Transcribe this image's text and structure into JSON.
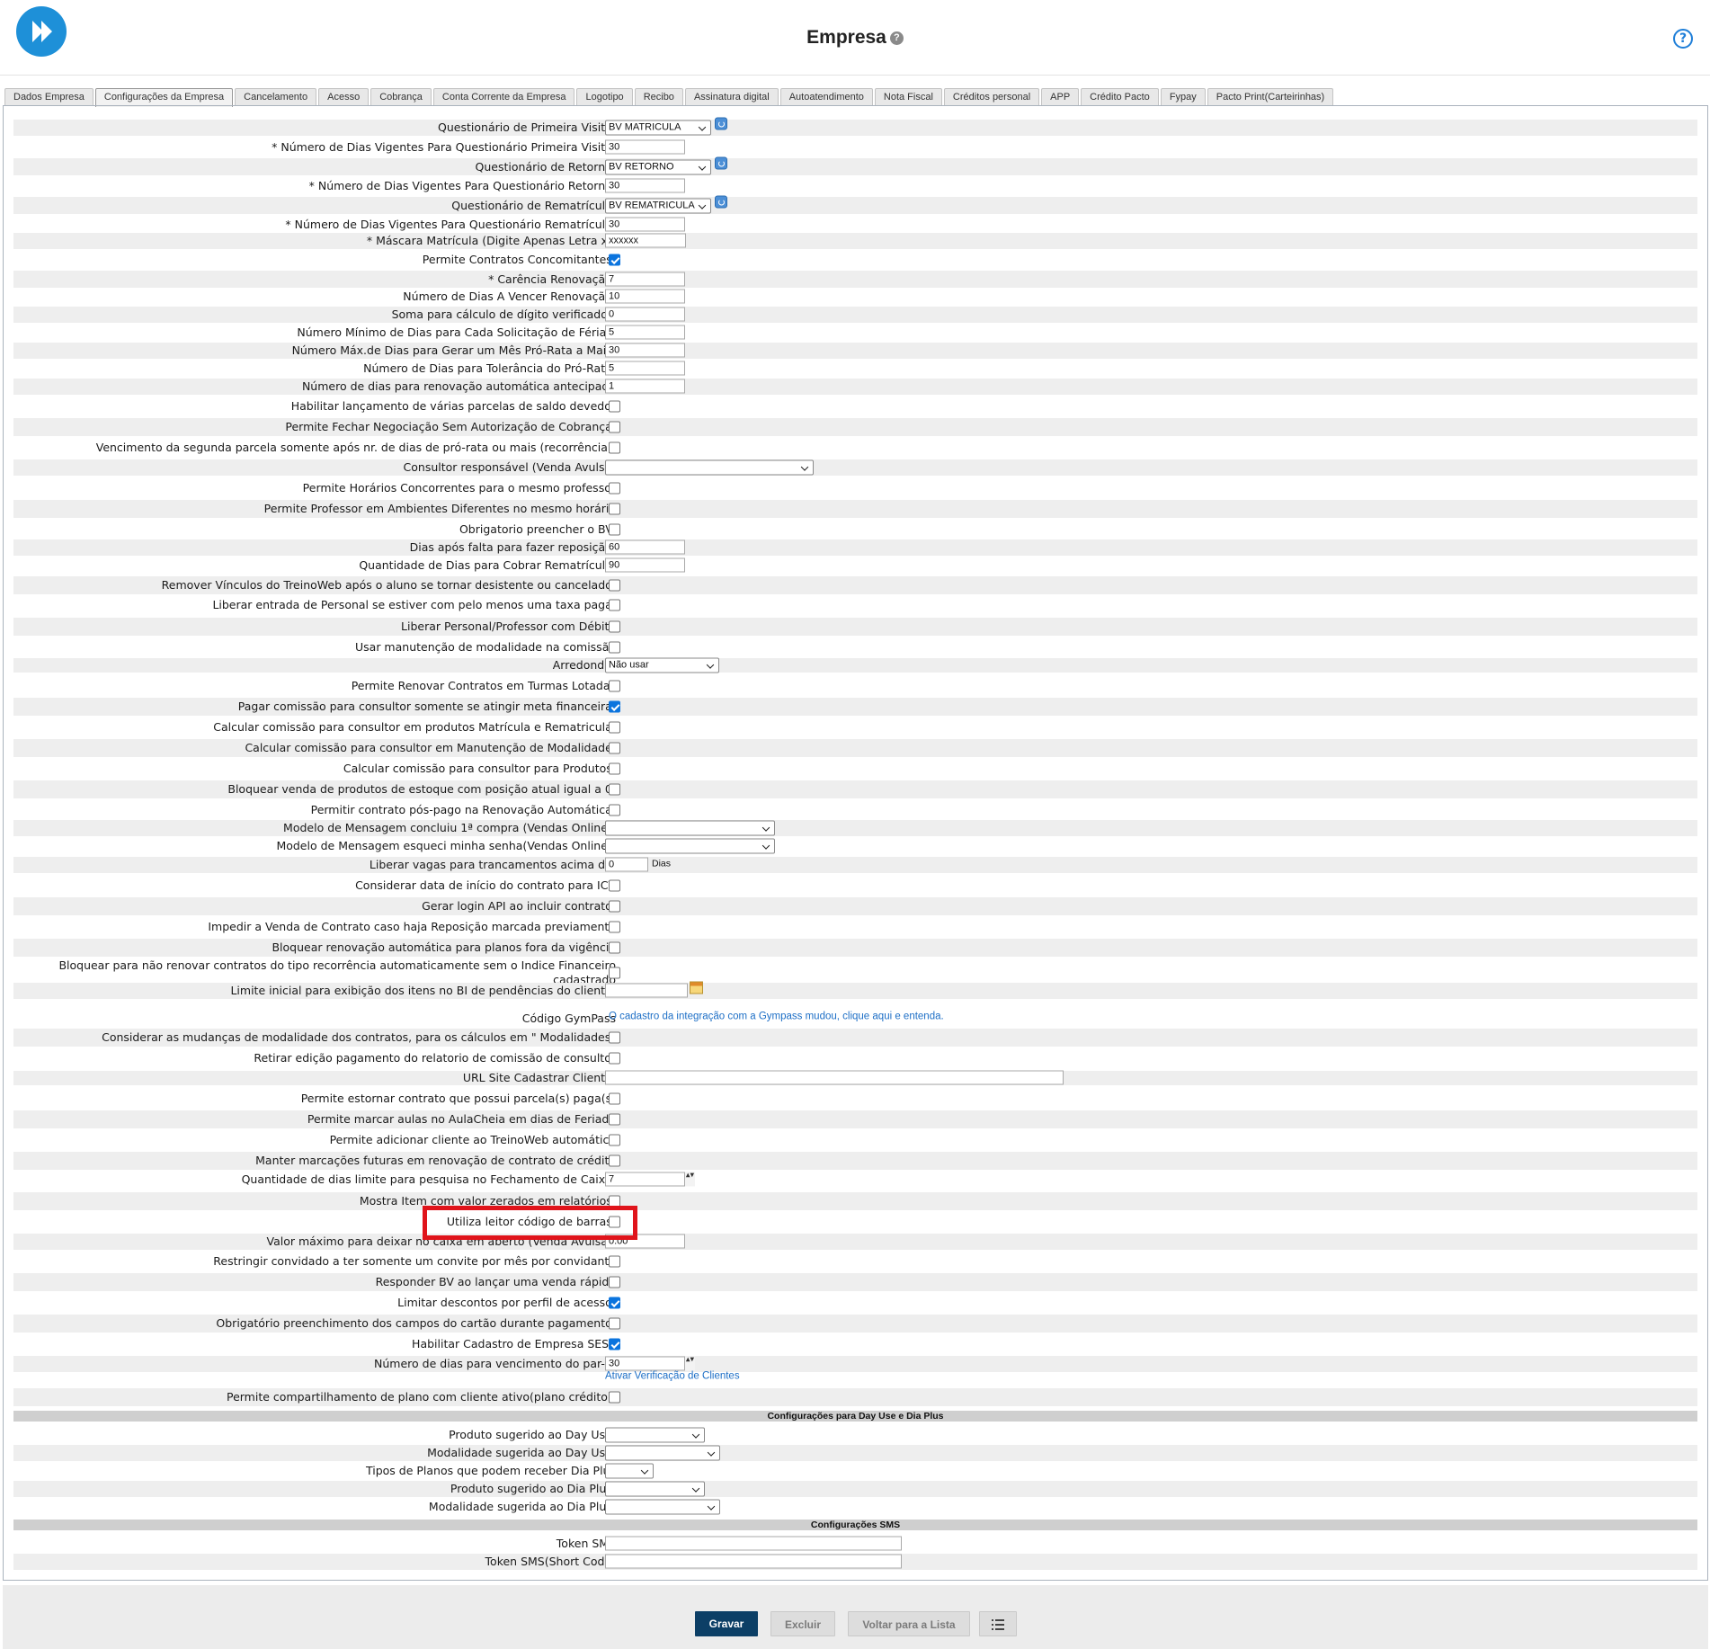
{
  "header": {
    "title": "Empresa",
    "title_help": "?",
    "help": "?"
  },
  "tabs": [
    "Dados Empresa",
    "Configurações da Empresa",
    "Cancelamento",
    "Acesso",
    "Cobrança",
    "Conta Corrente da Empresa",
    "Logotipo",
    "Recibo",
    "Assinatura digital",
    "Autoatendimento",
    "Nota Fiscal",
    "Créditos personal",
    "APP",
    "Crédito Pacto",
    "Fypay",
    "Pacto Print(Carteirinhas)"
  ],
  "active_tab": "Configurações da Empresa",
  "fields": [
    {
      "label": "Questionário de Primeira Visita:",
      "type": "select",
      "value": "BV MATRICULA",
      "refresh": true
    },
    {
      "label": "* Número de Dias Vigentes Para Questionário Primeira Visita:",
      "type": "input",
      "value": "30"
    },
    {
      "label": "Questionário de Retorno:",
      "type": "select",
      "value": "BV RETORNO",
      "refresh": true
    },
    {
      "label": "* Número de Dias Vigentes Para Questionário Retorno:",
      "type": "input",
      "value": "30"
    },
    {
      "label": "Questionário de Rematrícula:",
      "type": "select",
      "value": "BV REMATRICULA",
      "refresh": true
    },
    {
      "label": "* Número de Dias Vigentes Para Questionário Rematrícula:",
      "type": "input",
      "value": "30"
    },
    {
      "label": "* Máscara Matrícula (Digite Apenas Letra x):",
      "type": "input",
      "value": "xxxxxx"
    },
    {
      "label": "Permite Contratos Concomitantes:",
      "type": "checkbox",
      "checked": true
    },
    {
      "label": "* Carência Renovação:",
      "type": "input",
      "value": "7"
    },
    {
      "label": "Número de Dias A Vencer Renovação:",
      "type": "input",
      "value": "10"
    },
    {
      "label": "Soma para cálculo de dígito verificador:",
      "type": "input",
      "value": "0"
    },
    {
      "label": "Número Mínimo de Dias para Cada Solicitação de Férias:",
      "type": "input",
      "value": "5"
    },
    {
      "label": "Número Máx.de Dias para Gerar um Mês Pró-Rata a Mais:",
      "type": "input",
      "value": "30"
    },
    {
      "label": "Número de Dias para Tolerância do Pró-Rata:",
      "type": "input",
      "value": "5"
    },
    {
      "label": "Número de dias para renovação automática antecipada",
      "type": "input",
      "value": "1"
    },
    {
      "label": "Habilitar lançamento de várias parcelas de saldo devedor",
      "type": "checkbox",
      "checked": false
    },
    {
      "label": "Permite Fechar Negociação Sem Autorização de Cobrança:",
      "type": "checkbox",
      "checked": false
    },
    {
      "label": "Vencimento da segunda parcela somente após nr. de dias de pró-rata ou mais (recorrência):",
      "type": "checkbox",
      "checked": false
    },
    {
      "label": "Consultor responsável (Venda Avulsa)",
      "type": "select",
      "value": ""
    },
    {
      "label": "Permite Horários Concorrentes para o mesmo professor",
      "type": "checkbox",
      "checked": false
    },
    {
      "label": "Permite Professor em Ambientes Diferentes no mesmo horário",
      "type": "checkbox",
      "checked": false
    },
    {
      "label": "Obrigatorio preencher o BV:",
      "type": "checkbox",
      "checked": false
    },
    {
      "label": "Dias após falta para fazer reposição:",
      "type": "input",
      "value": "60"
    },
    {
      "label": "Quantidade de Dias para Cobrar Rematrícula:",
      "type": "input",
      "value": "90"
    },
    {
      "label": "Remover Vínculos do TreinoWeb após o aluno se tornar desistente ou cancelado:",
      "type": "checkbox",
      "checked": false
    },
    {
      "label": "Liberar entrada de Personal se estiver com pelo menos uma taxa paga:",
      "type": "checkbox",
      "checked": false
    },
    {
      "label": "Liberar Personal/Professor com Débito",
      "type": "checkbox",
      "checked": false
    },
    {
      "label": "Usar manutenção de modalidade na comissão",
      "type": "checkbox",
      "checked": false
    },
    {
      "label": "Arredondar",
      "type": "select",
      "value": "Não usar"
    },
    {
      "label": "Permite Renovar Contratos em Turmas Lotadas",
      "type": "checkbox",
      "checked": false
    },
    {
      "label": "Pagar comissão para consultor somente se atingir meta financeira:",
      "type": "checkbox",
      "checked": true
    },
    {
      "label": "Calcular comissão para consultor em produtos Matrícula e Rematricula:",
      "type": "checkbox",
      "checked": false
    },
    {
      "label": "Calcular comissão para consultor em Manutenção de Modalidade:",
      "type": "checkbox",
      "checked": false
    },
    {
      "label": "Calcular comissão para consultor para Produtos:",
      "type": "checkbox",
      "checked": false
    },
    {
      "label": "Bloquear venda de produtos de estoque com posição atual igual a 0:",
      "type": "checkbox",
      "checked": false
    },
    {
      "label": "Permitir contrato pós-pago na Renovação Automática:",
      "type": "checkbox",
      "checked": false
    },
    {
      "label": "Modelo de Mensagem concluiu 1ª compra (Vendas Online):",
      "type": "select",
      "value": ""
    },
    {
      "label": "Modelo de Mensagem esqueci minha senha(Vendas Online):",
      "type": "select",
      "value": ""
    },
    {
      "label": "Liberar vagas para trancamentos acima de:",
      "type": "input",
      "value": "0",
      "suffix": "Dias"
    },
    {
      "label": "Considerar data de início do contrato para ICV",
      "type": "checkbox",
      "checked": false
    },
    {
      "label": "Gerar login API ao incluir contrato:",
      "type": "checkbox",
      "checked": false
    },
    {
      "label": "Impedir a Venda de Contrato caso haja Reposição marcada previamente",
      "type": "checkbox",
      "checked": false
    },
    {
      "label": "Bloquear renovação automática para planos fora da vigência",
      "type": "checkbox",
      "checked": false
    },
    {
      "label": "Bloquear para não renovar contratos do tipo recorrência automaticamente sem o Indice Financeiro cadastrado",
      "type": "checkbox",
      "checked": false
    },
    {
      "label": "Limite inicial para exibição dos itens no BI de pendências do cliente:",
      "type": "date",
      "value": ""
    },
    {
      "label": "Código GymPass",
      "type": "link",
      "value": "O cadastro da integração com a Gympass mudou, clique aqui e entenda."
    },
    {
      "label": "Considerar as mudanças de modalidade dos contratos, para os cálculos em \" Modalidades\"",
      "type": "checkbox",
      "checked": false
    },
    {
      "label": "Retirar edição pagamento do relatorio de comissão de consultor",
      "type": "checkbox",
      "checked": false
    },
    {
      "label": "URL Site Cadastrar Cliente:",
      "type": "input",
      "value": ""
    },
    {
      "label": "Permite estornar contrato que possui parcela(s) paga(s)",
      "type": "checkbox",
      "checked": false
    },
    {
      "label": "Permite marcar aulas no AulaCheia em dias de Feriado",
      "type": "checkbox",
      "checked": false
    },
    {
      "label": "Permite adicionar cliente ao TreinoWeb automático",
      "type": "checkbox",
      "checked": false
    },
    {
      "label": "Manter marcações futuras em renovação de contrato de crédito",
      "type": "checkbox",
      "checked": false
    },
    {
      "label": "Quantidade de dias limite para pesquisa no Fechamento de Caixa:",
      "type": "number",
      "value": "7"
    },
    {
      "label": "Mostra Item com valor zerados em relatórios:",
      "type": "checkbox",
      "checked": false
    },
    {
      "label": "Utiliza leitor código de barras:",
      "type": "checkbox",
      "checked": false
    },
    {
      "label": "Valor máximo para deixar no caixa em aberto (Venda Avulsa):",
      "type": "input",
      "value": "0.00"
    },
    {
      "label": "Restringir convidado a ter somente um convite por mês por convidante",
      "type": "checkbox",
      "checked": false
    },
    {
      "label": "Responder BV ao lançar uma venda rápida",
      "type": "checkbox",
      "checked": false
    },
    {
      "label": "Limitar descontos por perfil de acesso:",
      "type": "checkbox",
      "checked": true
    },
    {
      "label": "Obrigatório preenchimento dos campos do cartão durante pagamento:",
      "type": "checkbox",
      "checked": false
    },
    {
      "label": "Habilitar Cadastro de Empresa SESI:",
      "type": "checkbox",
      "checked": true
    },
    {
      "label": "Número de dias para vencimento do par-q:",
      "type": "number",
      "value": "30"
    },
    {
      "label": "",
      "type": "link",
      "value": "Ativar Verificação de Clientes"
    },
    {
      "label": "Permite compartilhamento de plano com cliente ativo(plano crédito):",
      "type": "checkbox",
      "checked": false
    }
  ],
  "sections": {
    "day_use": {
      "title": "Configurações para Day Use e Dia Plus",
      "fields": [
        {
          "label": "Produto sugerido ao Day Use:",
          "type": "select",
          "value": ""
        },
        {
          "label": "Modalidade sugerida ao Day Use:",
          "type": "select",
          "value": ""
        },
        {
          "label": "Tipos de Planos que podem receber Dia Plus",
          "type": "select",
          "value": ""
        },
        {
          "label": "Produto sugerido ao Dia Plus:",
          "type": "select",
          "value": ""
        },
        {
          "label": "Modalidade sugerida ao Dia Plus:",
          "type": "select",
          "value": ""
        }
      ]
    },
    "sms": {
      "title": "Configurações SMS",
      "fields": [
        {
          "label": "Token SMS",
          "type": "input",
          "value": ""
        },
        {
          "label": "Token SMS(Short Code)",
          "type": "input",
          "value": ""
        }
      ]
    }
  },
  "footer": {
    "save": "Gravar",
    "delete": "Excluir",
    "back": "Voltar para a Lista",
    "list_icon": "list-icon"
  },
  "colors": {
    "primary": "#0c3f66",
    "accent": "#1e90d8",
    "highlight": "#e0141b",
    "link": "#1c6ec6"
  }
}
